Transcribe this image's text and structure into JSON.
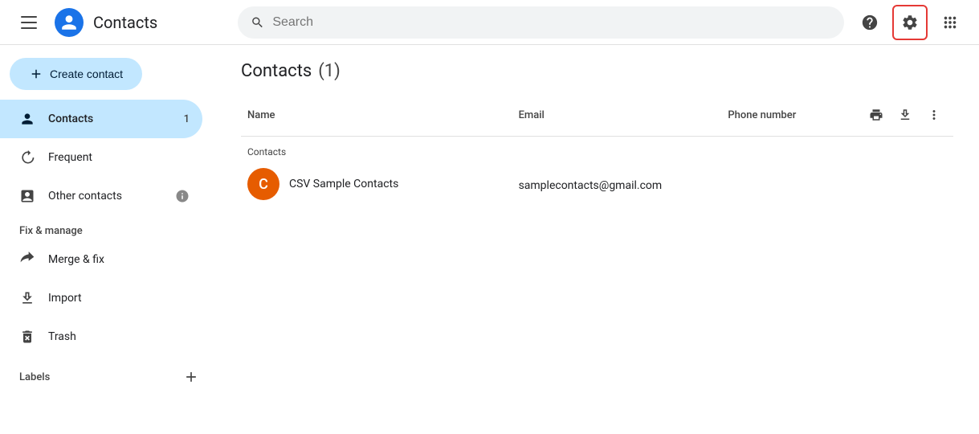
{
  "app": {
    "title": "Contacts",
    "search_placeholder": "Search"
  },
  "topbar": {
    "help_label": "Help",
    "settings_label": "Settings",
    "apps_label": "Google apps"
  },
  "sidebar": {
    "create_btn_label": "Create contact",
    "items": [
      {
        "id": "contacts",
        "label": "Contacts",
        "badge": "1",
        "active": true
      },
      {
        "id": "frequent",
        "label": "Frequent",
        "badge": "",
        "active": false
      },
      {
        "id": "other-contacts",
        "label": "Other contacts",
        "badge": "",
        "info": true,
        "active": false
      }
    ],
    "fix_manage_label": "Fix & manage",
    "manage_items": [
      {
        "id": "merge-fix",
        "label": "Merge & fix"
      },
      {
        "id": "import",
        "label": "Import"
      },
      {
        "id": "trash",
        "label": "Trash"
      }
    ],
    "labels_section": "Labels",
    "add_label_btn": "+"
  },
  "content": {
    "title": "Contacts",
    "count": "(1)",
    "columns": {
      "name": "Name",
      "email": "Email",
      "phone": "Phone number"
    },
    "group_label": "Contacts",
    "contact": {
      "avatar_letter": "C",
      "name": "CSV Sample Contacts",
      "email": "samplecontacts@gmail.com",
      "phone": ""
    }
  }
}
